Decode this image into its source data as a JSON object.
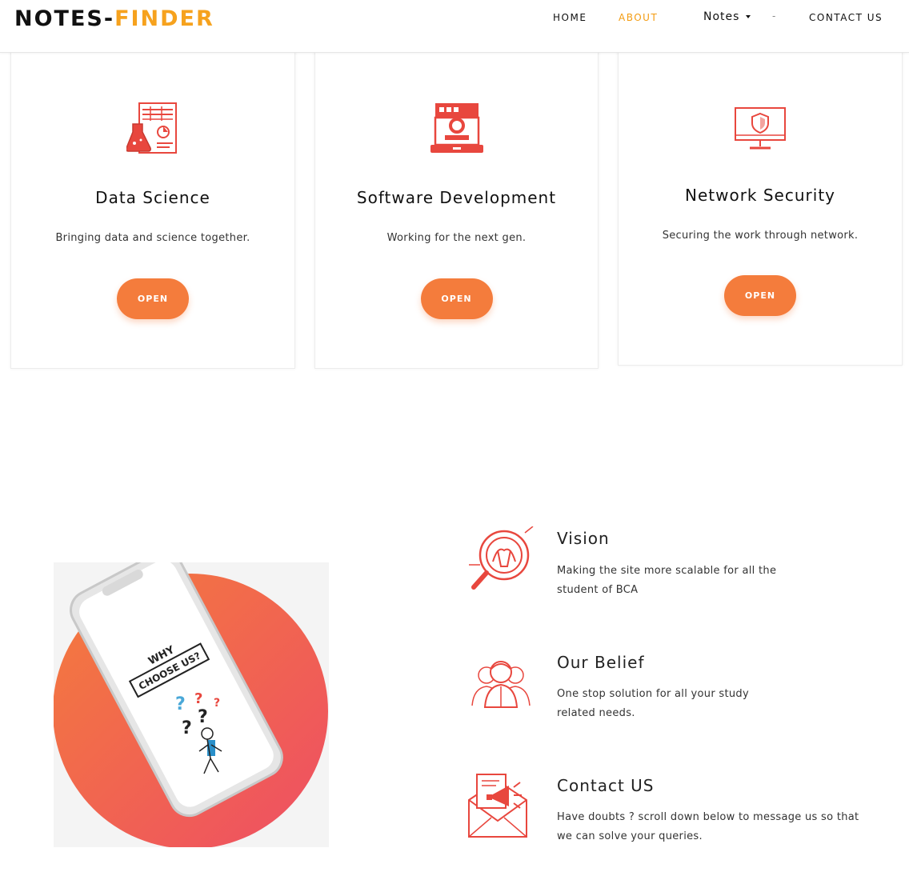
{
  "header": {
    "logo_part1": "NOTES-",
    "logo_part2": "FINDER",
    "nav": {
      "home": "HOME",
      "about": "ABOUT",
      "notes": "Notes",
      "separator": "-",
      "contact": "CONTACT US"
    }
  },
  "cards": [
    {
      "icon": "science-lab-icon",
      "title": "Data Science",
      "text": "Bringing data and science together.",
      "button": "OPEN"
    },
    {
      "icon": "software-app-icon",
      "title": "Software Development",
      "text": "Working for the next gen.",
      "button": "OPEN"
    },
    {
      "icon": "security-monitor-icon",
      "title": "Network Security",
      "text": "Securing the work through network.",
      "button": "OPEN"
    }
  ],
  "features": [
    {
      "icon": "vision-magnifier-icon",
      "title": "Vision",
      "line1": "Making the site more scalable for all the",
      "line2": "student of BCA"
    },
    {
      "icon": "team-people-icon",
      "title": "Our Belief",
      "line1": "One stop solution for all your study",
      "line2": "related needs."
    },
    {
      "icon": "mail-megaphone-icon",
      "title": "Contact US",
      "line1": "Have doubts ? scroll down below to message us so that",
      "line2": "we can solve your queries."
    }
  ],
  "illustration": {
    "phone_text_line1": "WHY",
    "phone_text_line2": "CHOOSE US?"
  },
  "colors": {
    "accent": "#f47c3c",
    "logo_accent": "#f6a21e",
    "icon_red": "#e8473e"
  }
}
